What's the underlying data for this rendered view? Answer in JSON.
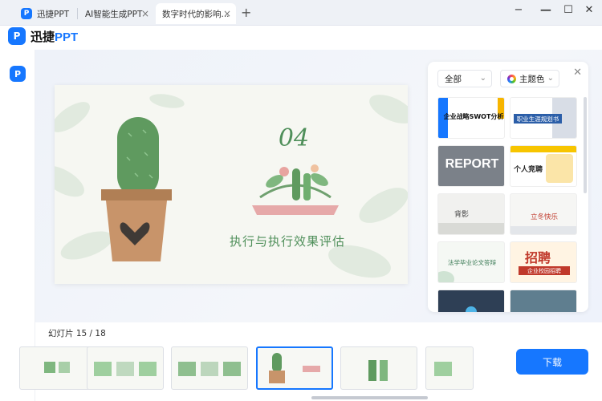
{
  "tabs": [
    {
      "label": "迅捷PPT"
    },
    {
      "label": "AI智能生成PPT"
    },
    {
      "label": "数字时代的影响..."
    }
  ],
  "window": {
    "minimize": "−",
    "restore": "☐",
    "close": "✕"
  },
  "app": {
    "logo_letter": "P",
    "logo_text_main": "迅捷",
    "logo_text_accent": "PPT"
  },
  "slide": {
    "number": "04",
    "title": "执行与执行效果评估"
  },
  "panel": {
    "filter_all": "全部",
    "filter_theme": "主题色",
    "templates": [
      {
        "label": "企业战略SWOT分析"
      },
      {
        "label": "职业生涯规划书"
      },
      {
        "label": "REPORT"
      },
      {
        "label": "个人竞聘"
      },
      {
        "label": "背影"
      },
      {
        "label": "立冬快乐"
      },
      {
        "label": "法学毕业论文答辩"
      },
      {
        "label": "企业校园招聘"
      },
      {
        "label": ""
      },
      {
        "label": ""
      }
    ]
  },
  "bottom": {
    "slide_counter": "幻灯片 15 / 18",
    "download_label": "下载"
  }
}
